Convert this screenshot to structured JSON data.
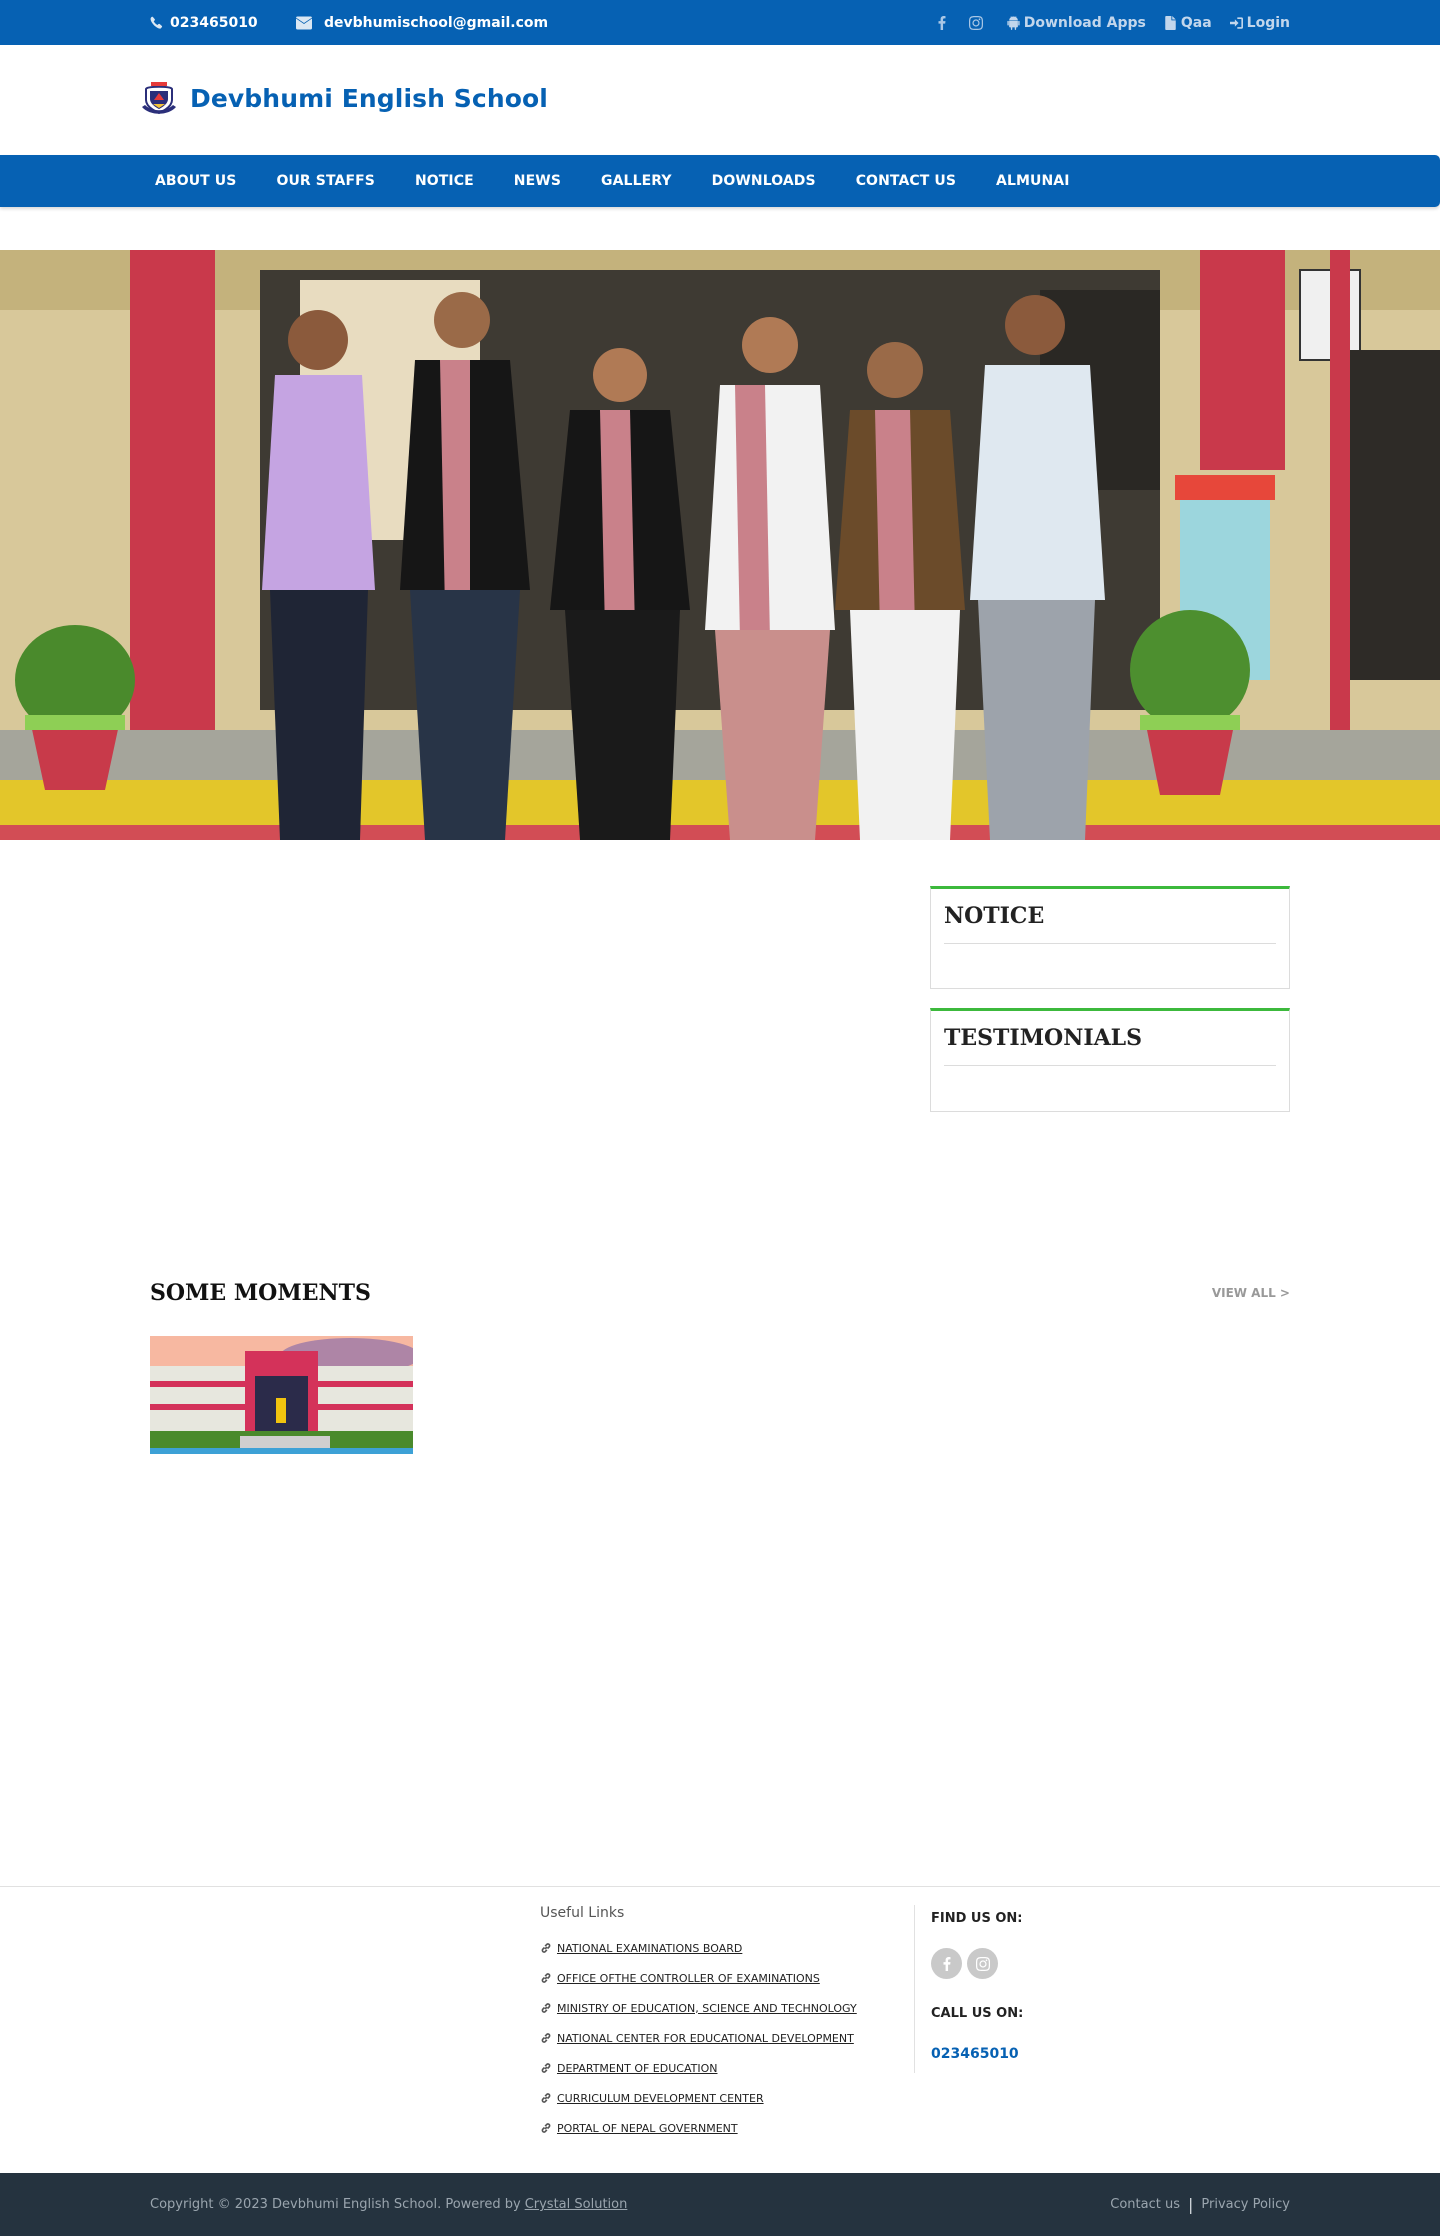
{
  "topbar": {
    "phone": "023465010",
    "email": "devbhumischool@gmail.com",
    "download_apps": "Download Apps",
    "qaa": "Qaa",
    "login": "Login"
  },
  "header": {
    "school_name": "Devbhumi English School"
  },
  "nav": {
    "items": [
      "ABOUT US",
      "OUR STAFFS",
      "NOTICE",
      "NEWS",
      "GALLERY",
      "DOWNLOADS",
      "CONTACT US",
      "ALMUNAI"
    ]
  },
  "sidebar": {
    "notice_title": "NOTICE",
    "testimonials_title": "TESTIMONIALS"
  },
  "moments": {
    "title": "SOME MOMENTS",
    "view_all": "VIEW ALL >"
  },
  "footer": {
    "useful_links_title": "Useful Links",
    "links": [
      "NATIONAL EXAMINATIONS BOARD",
      "OFFICE OFTHE CONTROLLER OF EXAMINATIONS",
      "MINISTRY OF EDUCATION, SCIENCE AND TECHNOLOGY",
      "NATIONAL CENTER FOR EDUCATIONAL DEVELOPMENT",
      "DEPARTMENT OF EDUCATION",
      "CURRICULUM DEVELOPMENT CENTER",
      "PORTAL OF NEPAL GOVERNMENT"
    ],
    "find_us": "FIND US ON:",
    "call_us": "CALL US ON:",
    "call_number": "023465010"
  },
  "bottom": {
    "copyright": "Copyright © 2023 Devbhumi English School. Powered by",
    "powered_link": "Crystal Solution",
    "contact": "Contact us",
    "privacy": "Privacy Policy"
  },
  "colors": {
    "brand_blue": "#0661b3",
    "accent_green": "#3cb93c",
    "footer_dark": "#25333f"
  }
}
